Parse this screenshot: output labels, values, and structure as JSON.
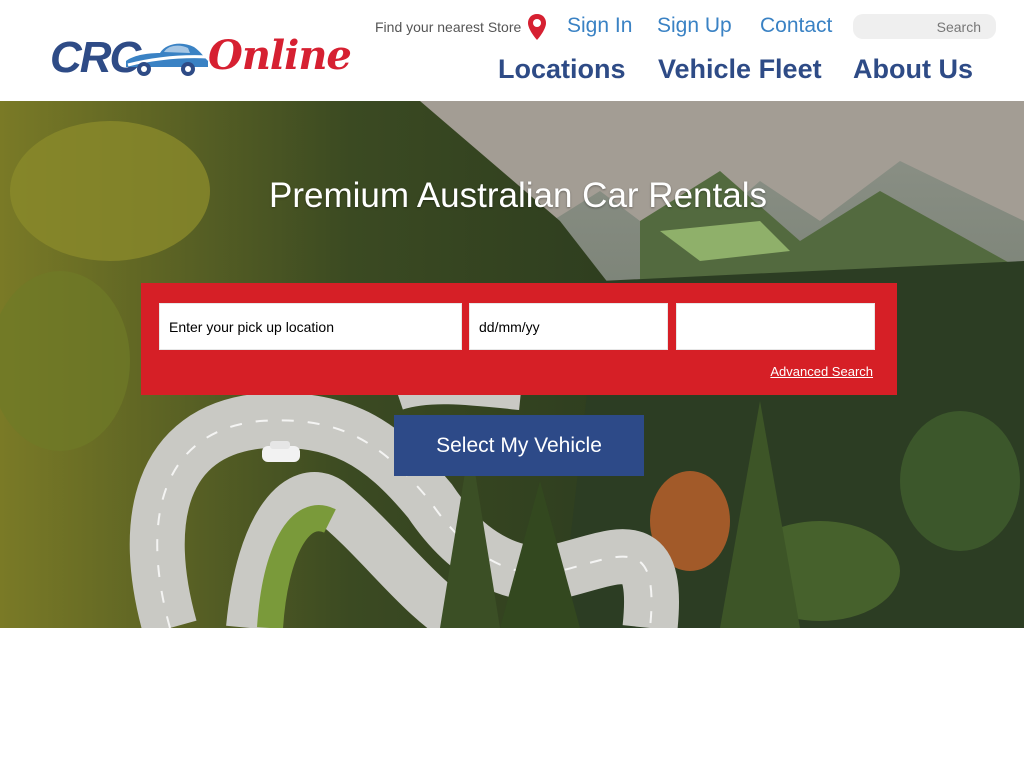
{
  "brand": {
    "logo_part1": "CRC",
    "logo_part2": "Online",
    "primary_color": "#2e4b86",
    "accent_color": "#d62031"
  },
  "header": {
    "store_finder_label": "Find your nearest Store",
    "store_finder_icon": "map-pin-icon",
    "top_links": [
      "Sign In",
      "Sign Up",
      "Contact"
    ],
    "search_placeholder": "Search",
    "main_nav": [
      "Locations",
      "Vehicle Fleet",
      "About Us"
    ]
  },
  "hero": {
    "title": "Premium Australian Car Rentals",
    "pickup_placeholder": "Enter your pick up location",
    "date_placeholder": "dd/mm/yy",
    "third_field_placeholder": "",
    "advanced_search_label": "Advanced Search",
    "cta_label": "Select My Vehicle",
    "panel_color": "#d61f26",
    "cta_color": "#2d4a88"
  }
}
